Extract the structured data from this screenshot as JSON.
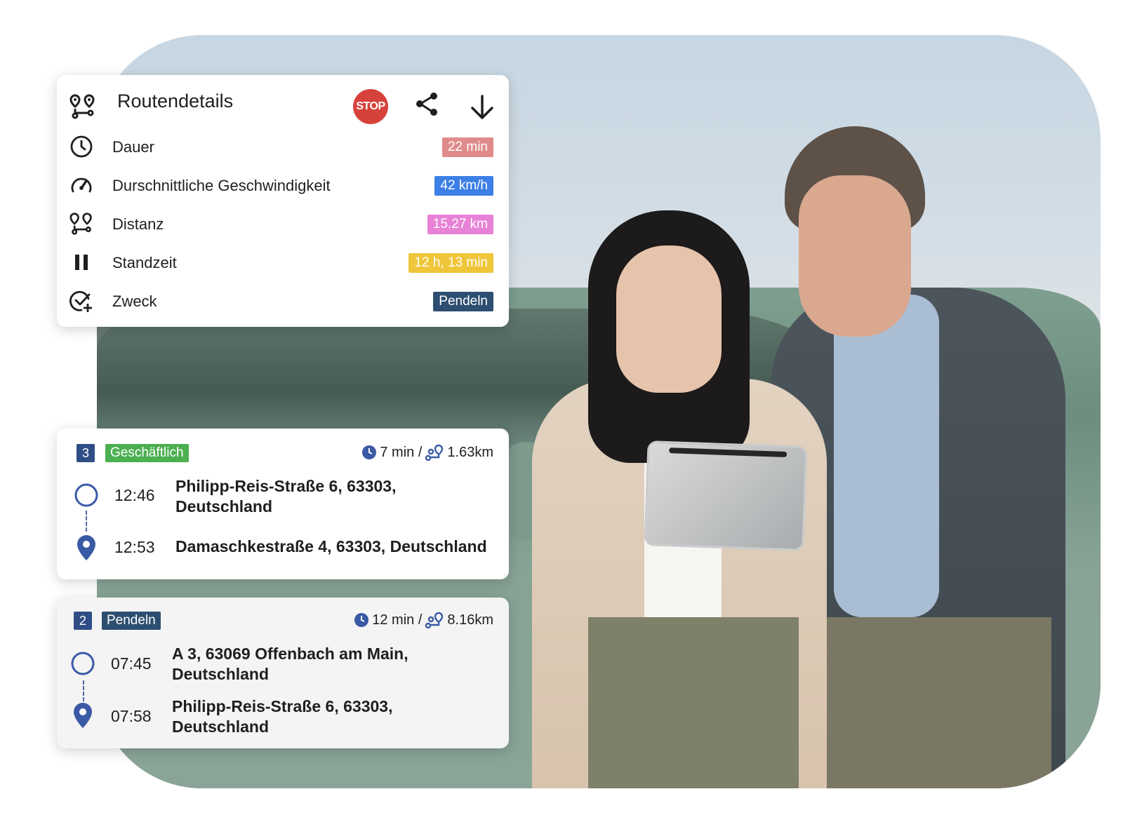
{
  "colors": {
    "duration_badge": "#e08b8b",
    "speed_badge": "#3c7fe6",
    "distance_badge": "#e882d6",
    "standzeit_badge": "#efc53a",
    "purpose_badge": "#2d4e70",
    "stop_button": "#d6423b",
    "icon_blue": "#3a5aa6",
    "business_badge": "#4caf50",
    "commute_badge": "#2d4e70"
  },
  "details": {
    "title": "Routendetails",
    "stop_label": "STOP",
    "rows": [
      {
        "icon": "clock-icon",
        "label": "Dauer",
        "value": "22 min"
      },
      {
        "icon": "speedometer-icon",
        "label": "Durschnittliche Geschwindigkeit",
        "value": "42 km/h"
      },
      {
        "icon": "route-pins-icon",
        "label": "Distanz",
        "value": "15.27 km"
      },
      {
        "icon": "pause-icon",
        "label": "Standzeit",
        "value": "12 h, 13 min"
      },
      {
        "icon": "check-add-icon",
        "label": "Zweck",
        "value": "Pendeln"
      }
    ]
  },
  "trips": [
    {
      "number": "3",
      "category": "Geschäftlich",
      "duration": "7 min /",
      "distance": "1.63km",
      "start_time": "12:46",
      "start_address": "Philipp-Reis-Straße 6, 63303, Deutschland",
      "end_time": "12:53",
      "end_address": "Damaschkestraße 4, 63303, Deutschland"
    },
    {
      "number": "2",
      "category": "Pendeln",
      "duration": "12 min /",
      "distance": "8.16km",
      "start_time": "07:45",
      "start_address": "A 3, 63069 Offenbach am Main, Deutschland",
      "end_time": "07:58",
      "end_address": "Philipp-Reis-Straße 6, 63303, Deutschland"
    }
  ]
}
